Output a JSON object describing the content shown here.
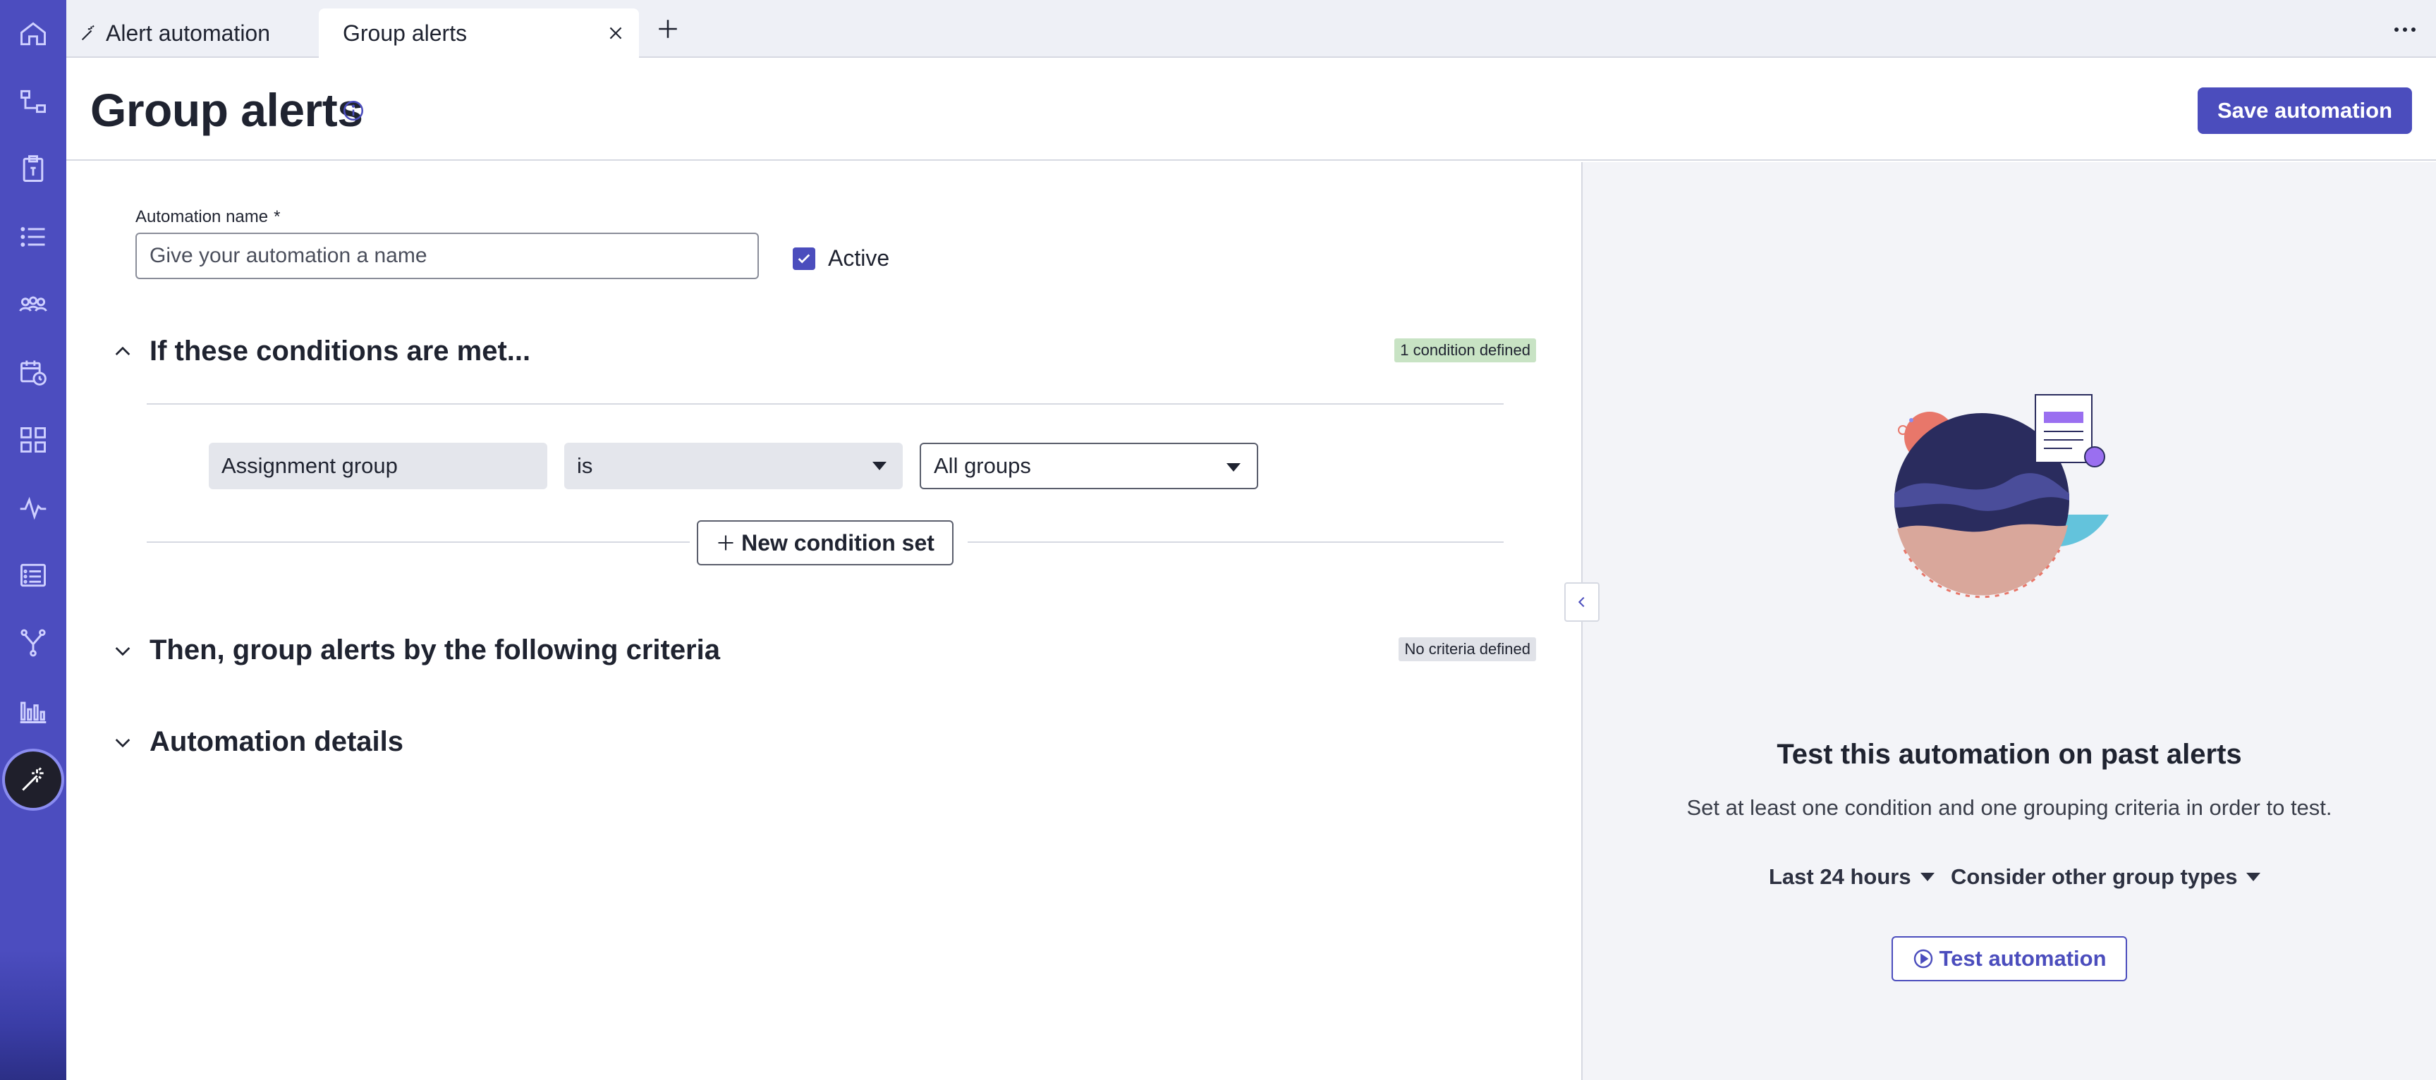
{
  "tabs": [
    {
      "label": "Alert automation",
      "icon": "wand-icon"
    },
    {
      "label": "Group alerts"
    }
  ],
  "page": {
    "title": "Group alerts",
    "save_label": "Save automation"
  },
  "form": {
    "name_label": "Automation name",
    "required_mark": "*",
    "name_placeholder": "Give your automation a name",
    "name_value": "",
    "active_label": "Active",
    "active_checked": true
  },
  "conditions": {
    "title": "If these conditions are met...",
    "badge": "1 condition defined",
    "field": "Assignment group",
    "operator": "is",
    "value": "All groups",
    "new_set_label": "New condition set"
  },
  "grouping": {
    "title": "Then, group alerts by the following criteria",
    "badge": "No criteria defined"
  },
  "details": {
    "title": "Automation details"
  },
  "side": {
    "title": "Test this automation on past alerts",
    "description": "Set at least one condition and one grouping criteria in order to test.",
    "range_label": "Last 24 hours",
    "group_types_label": "Consider other group types",
    "test_label": "Test automation"
  },
  "colors": {
    "accent": "#4b4dbd",
    "rail": "#4c4dbf",
    "badge_green": "#c8e3c4",
    "badge_grey": "#e0e2e8"
  }
}
